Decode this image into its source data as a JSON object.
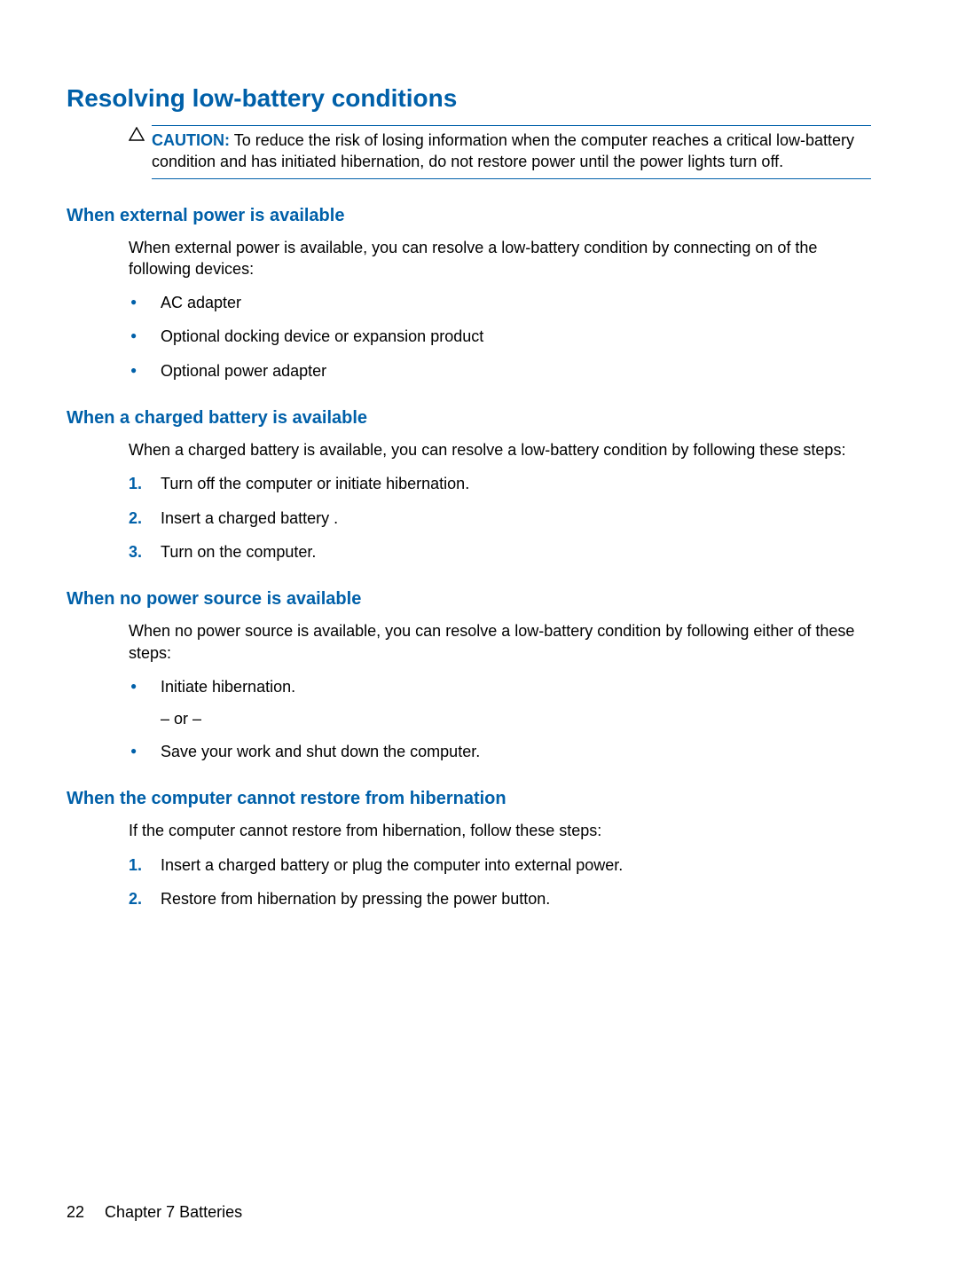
{
  "heading_main": "Resolving low-battery conditions",
  "caution_label": "CAUTION:",
  "caution_text": "To reduce the risk of losing information when the computer reaches a critical low-battery condition and has initiated hibernation, do not restore power until the power lights turn off.",
  "section1": {
    "heading": "When external power is available",
    "paragraph": "When external power is available, you can resolve a low-battery condition by connecting on of the following devices:",
    "bullets": [
      "AC adapter",
      "Optional docking device or expansion product",
      "Optional power adapter"
    ]
  },
  "section2": {
    "heading": "When a charged battery is available",
    "paragraph": "When a charged battery is available, you can resolve a low-battery condition by following these steps:",
    "steps": [
      "Turn off the computer or initiate hibernation.",
      "Insert a charged battery .",
      "Turn on the computer."
    ]
  },
  "section3": {
    "heading": "When no power source is available",
    "paragraph": "When no power source is available, you can resolve a low-battery condition by following either of these steps:",
    "bullet1": "Initiate hibernation.",
    "or_text": "– or –",
    "bullet2": "Save your work and shut down the computer."
  },
  "section4": {
    "heading": "When the computer cannot restore from hibernation",
    "paragraph": "If the computer cannot restore from hibernation, follow these steps:",
    "steps": [
      "Insert a charged battery or plug the computer into external power.",
      "Restore from hibernation by pressing the power button."
    ]
  },
  "footer": {
    "page_number": "22",
    "chapter": "Chapter 7   Batteries"
  }
}
